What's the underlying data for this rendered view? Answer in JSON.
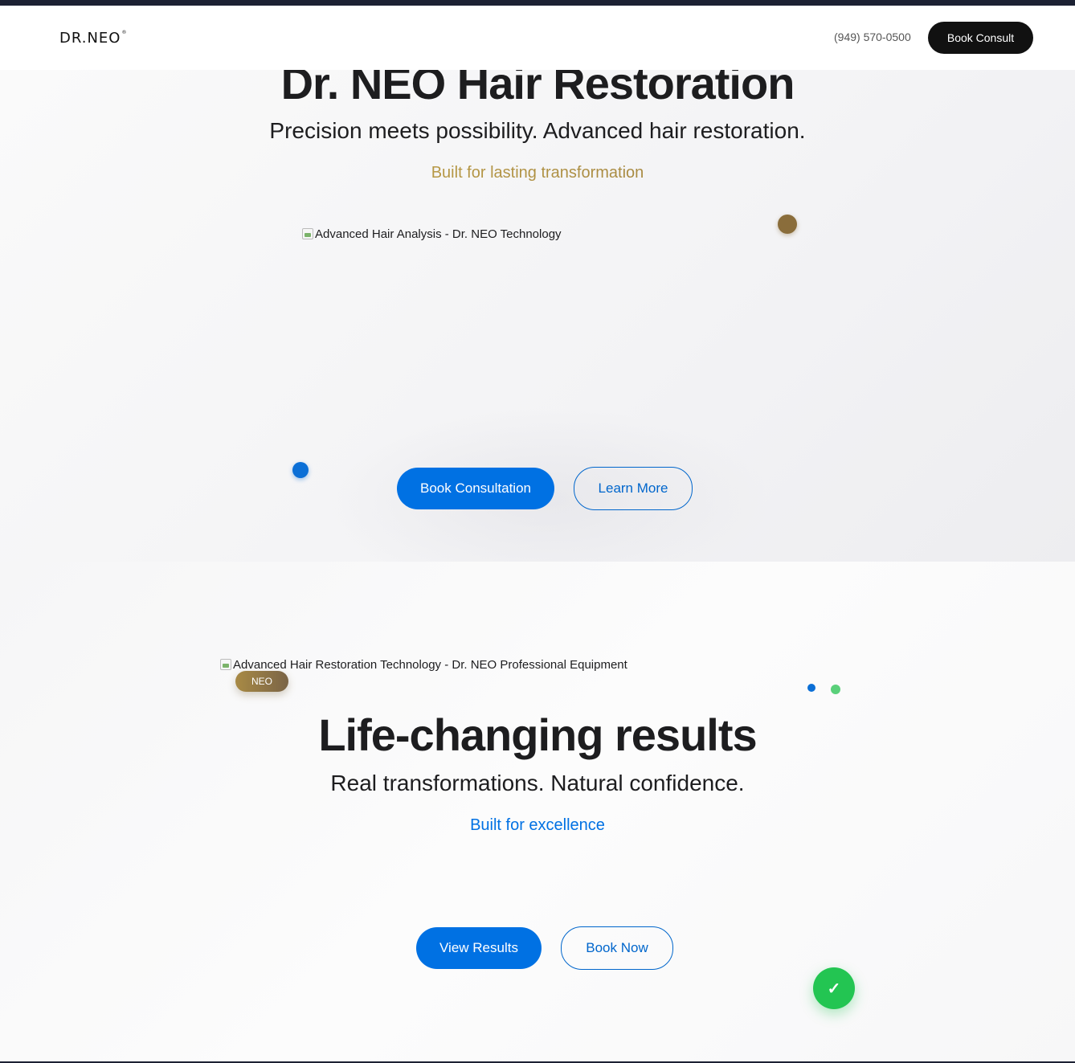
{
  "header": {
    "logo": "DR.NEO",
    "logo_mark": "®",
    "phone": "(949) 570-0500",
    "book_consult_label": "Book Consult"
  },
  "hero": {
    "title": "Dr. NEO Hair Restoration",
    "subtitle": "Precision meets possibility. Advanced hair restoration.",
    "tagline": "Built for lasting transformation",
    "image_alt": "Advanced Hair Analysis - Dr. NEO Technology",
    "primary_button": "Book Consultation",
    "secondary_button": "Learn More"
  },
  "results": {
    "image_alt": "Advanced Hair Restoration Technology - Dr. NEO Professional Equipment",
    "badge": "NEO",
    "title": "Life-changing results",
    "subtitle": "Real transformations. Natural confidence.",
    "tagline": "Built for excellence",
    "primary_button": "View Results",
    "secondary_button": "Book Now",
    "fab_icon": "checkmark-icon",
    "fab_glyph": "✓"
  },
  "colors": {
    "accent_blue": "#0071e3",
    "gold": "#a88a45",
    "dark": "#111111",
    "green": "#23c552"
  }
}
